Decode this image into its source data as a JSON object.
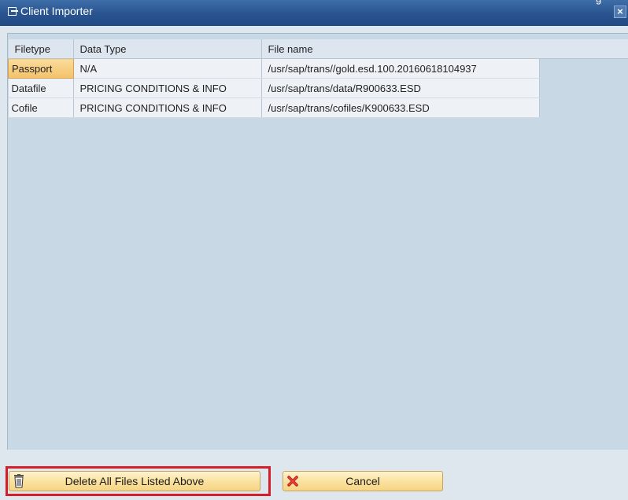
{
  "window": {
    "title": "Client Importer",
    "corner_glyph": "g",
    "close_glyph": "×"
  },
  "table": {
    "columns": [
      "Filetype",
      "Data Type",
      "File name"
    ],
    "rows": [
      {
        "filetype": "Passport",
        "data_type": "N/A",
        "file_name": "/usr/sap/trans//gold.esd.100.20160618104937",
        "selected": true
      },
      {
        "filetype": "Datafile",
        "data_type": "PRICING CONDITIONS & INFO",
        "file_name": "/usr/sap/trans/data/R900633.ESD",
        "selected": false
      },
      {
        "filetype": "Cofile",
        "data_type": "PRICING CONDITIONS & INFO",
        "file_name": "/usr/sap/trans/cofiles/K900633.ESD",
        "selected": false
      }
    ]
  },
  "buttons": {
    "delete_label": "Delete All Files Listed Above",
    "delete_icon": "trash-icon",
    "cancel_label": "Cancel",
    "cancel_icon": "red-x-icon"
  },
  "colors": {
    "title_bar": "#2a5590",
    "selection": "#f3c26b",
    "highlight_box": "#d61e2a"
  }
}
